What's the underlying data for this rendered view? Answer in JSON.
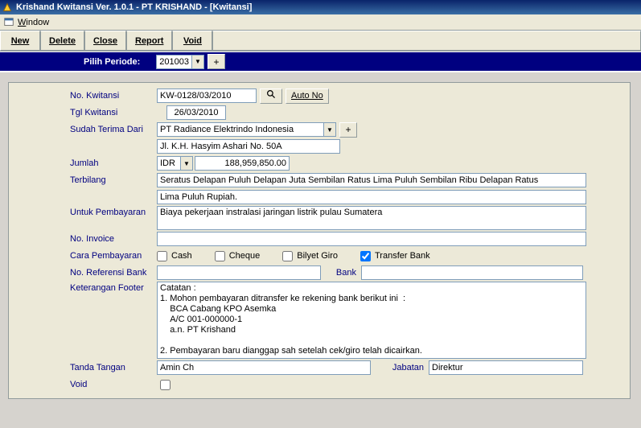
{
  "title": "Krishand Kwitansi Ver. 1.0.1 - PT KRISHAND - [Kwitansi]",
  "menubar": {
    "window": "Window"
  },
  "toolbar": {
    "new": "New",
    "delete": "Delete",
    "close": "Close",
    "report": "Report",
    "void": "Void"
  },
  "periode": {
    "label": "Pilih Periode:",
    "value": "201003",
    "plus": "+"
  },
  "labels": {
    "no_kwitansi": "No. Kwitansi",
    "tgl_kwitansi": "Tgl Kwitansi",
    "sudah_terima_dari": "Sudah Terima Dari",
    "jumlah": "Jumlah",
    "terbilang": "Terbilang",
    "untuk_pembayaran": "Untuk Pembayaran",
    "no_invoice": "No. Invoice",
    "cara_pembayaran": "Cara Pembayaran",
    "no_ref_bank": "No. Referensi Bank",
    "bank": "Bank",
    "keterangan_footer": "Keterangan Footer",
    "tanda_tangan": "Tanda Tangan",
    "jabatan": "Jabatan",
    "void": "Void"
  },
  "values": {
    "no_kwitansi": "KW-0128/03/2010",
    "auto_no": "Auto No",
    "tgl_kwitansi": "26/03/2010",
    "terima_dari": "PT Radiance Elektrindo Indonesia",
    "alamat": "Jl. K.H. Hasyim Ashari No. 50A",
    "currency": "IDR",
    "jumlah": "188,959,850.00",
    "terbilang1": "Seratus Delapan Puluh Delapan Juta Sembilan Ratus Lima Puluh Sembilan Ribu Delapan Ratus",
    "terbilang2": "Lima Puluh Rupiah.",
    "untuk_pembayaran": "Biaya pekerjaan instralasi jaringan listrik pulau Sumatera",
    "no_invoice": "",
    "no_ref_bank": "",
    "bank": "",
    "keterangan_footer": "Catatan :\n1. Mohon pembayaran ditransfer ke rekening bank berikut ini  :\n    BCA Cabang KPO Asemka\n    A/C 001-000000-1\n    a.n. PT Krishand\n\n2. Pembayaran baru dianggap sah setelah cek/giro telah dicairkan.",
    "tanda_tangan": "Amin Ch",
    "jabatan": "Direktur"
  },
  "pay": {
    "cash": "Cash",
    "cheque": "Cheque",
    "bilyet_giro": "Bilyet Giro",
    "transfer_bank": "Transfer Bank",
    "cash_checked": false,
    "cheque_checked": false,
    "giro_checked": false,
    "transfer_checked": true
  },
  "icons": {
    "search": "search-icon",
    "plus": "+"
  }
}
